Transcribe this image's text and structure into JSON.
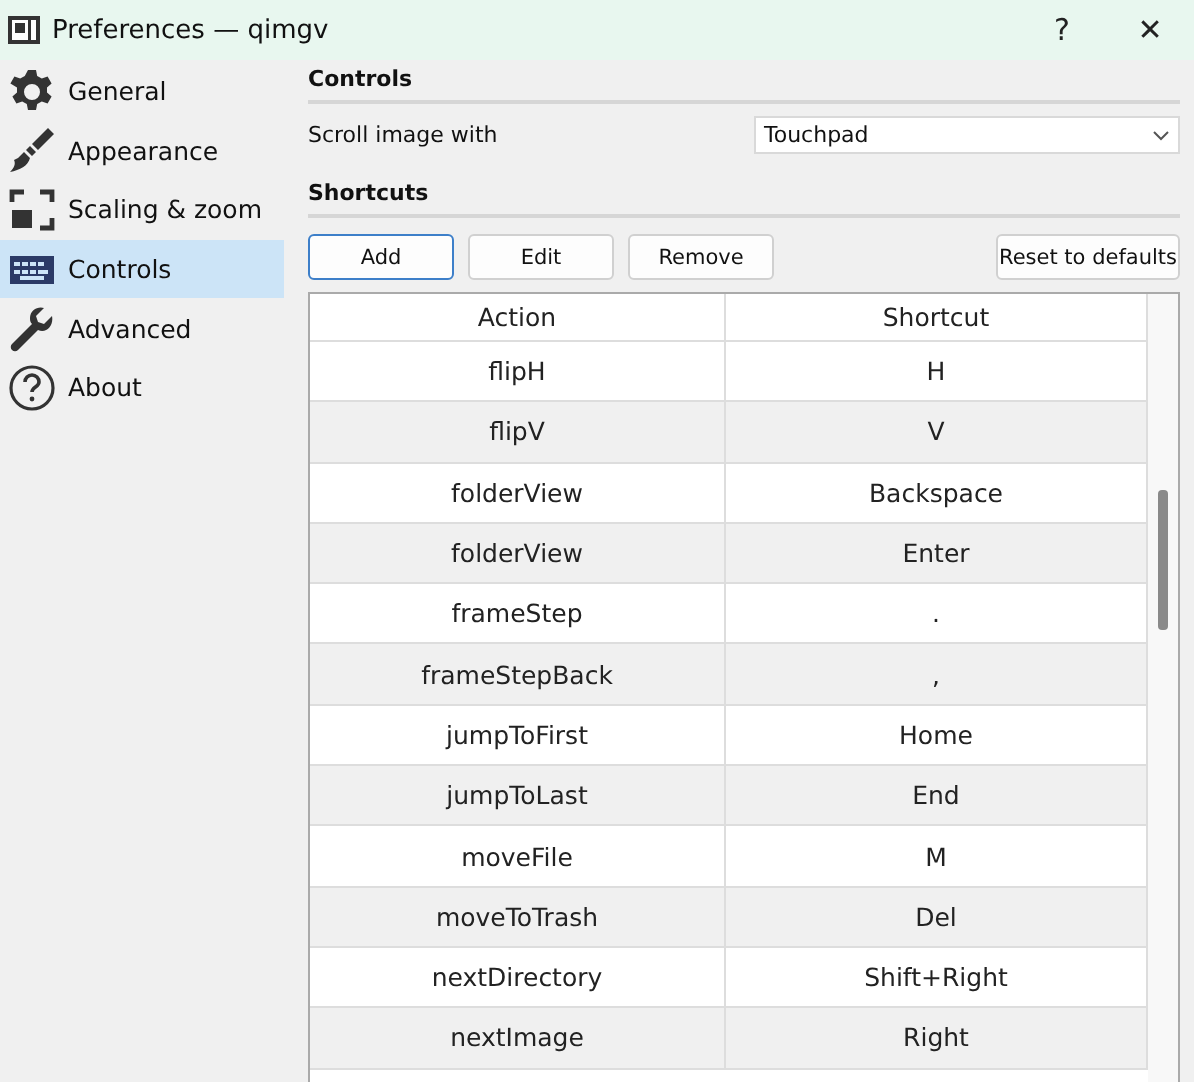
{
  "window": {
    "title": "Preferences — qimgv",
    "controls": [
      "?",
      "✕"
    ]
  },
  "sidebar": {
    "items": [
      {
        "label": "General",
        "selected": false
      },
      {
        "label": "Appearance",
        "selected": false
      },
      {
        "label": "Scaling & zoom",
        "selected": false
      },
      {
        "label": "Controls",
        "selected": true
      },
      {
        "label": "Advanced",
        "selected": false
      },
      {
        "label": "About",
        "selected": false
      }
    ]
  },
  "controls_section": {
    "title": "Controls",
    "scroll_label": "Scroll image with",
    "scroll_value": "Touchpad"
  },
  "shortcuts_section": {
    "title": "Shortcuts",
    "buttons": [
      {
        "label": "Add",
        "focused": true
      },
      {
        "label": "Edit",
        "focused": false
      },
      {
        "label": "Remove",
        "focused": false
      }
    ],
    "reset_button": "Reset to defaults",
    "table": {
      "columns": [
        "Action",
        "Shortcut"
      ],
      "rows": [
        [
          "flipH",
          "H"
        ],
        [
          "flipV",
          "V"
        ],
        [
          "folderView",
          "Backspace"
        ],
        [
          "folderView",
          "Enter"
        ],
        [
          "frameStep",
          "."
        ],
        [
          "frameStepBack",
          ","
        ],
        [
          "jumpToFirst",
          "Home"
        ],
        [
          "jumpToLast",
          "End"
        ],
        [
          "moveFile",
          "M"
        ],
        [
          "moveToTrash",
          "Del"
        ],
        [
          "nextDirectory",
          "Shift+Right"
        ],
        [
          "nextImage",
          "Right"
        ]
      ]
    }
  }
}
